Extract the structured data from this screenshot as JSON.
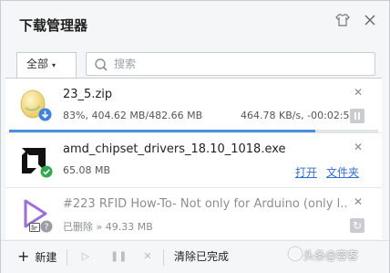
{
  "window": {
    "title": "下载管理器",
    "skin_icon": "tshirt-icon",
    "close_icon": "close-icon"
  },
  "toolbar": {
    "filter_label": "全部",
    "filter_caret": "▾",
    "search_placeholder": "搜索"
  },
  "downloads": [
    {
      "name": "23_5.zip",
      "icon": "zip-file-icon",
      "badge": "download-arrow-badge",
      "progress_text": "83%, 404.62 MB/482.66 MB",
      "speed_text": "464.78 KB/s, -00:02:51",
      "progress": 0.83,
      "progress_color": "#4a90e2"
    },
    {
      "name": "amd_chipset_drivers_18.10_1018.exe",
      "icon": "amd-exe-icon",
      "badge": "check-badge",
      "size_text": "65.08 MB",
      "open_label": "打开",
      "folder_label": "文件夹"
    },
    {
      "name": "#223 RFID How-To- Not only for Arduino (only l...",
      "icon": "video-file-icon",
      "badge": "question-badge",
      "status_text": "已删除 » 49.33 MB"
    }
  ],
  "bottombar": {
    "new_label": "新建",
    "clear_label": "清除已完成"
  },
  "watermark": {
    "text": "头条@容客"
  },
  "colors": {
    "accent": "#4a90e2",
    "link": "#2e6fd8",
    "success": "#2fa84f"
  }
}
